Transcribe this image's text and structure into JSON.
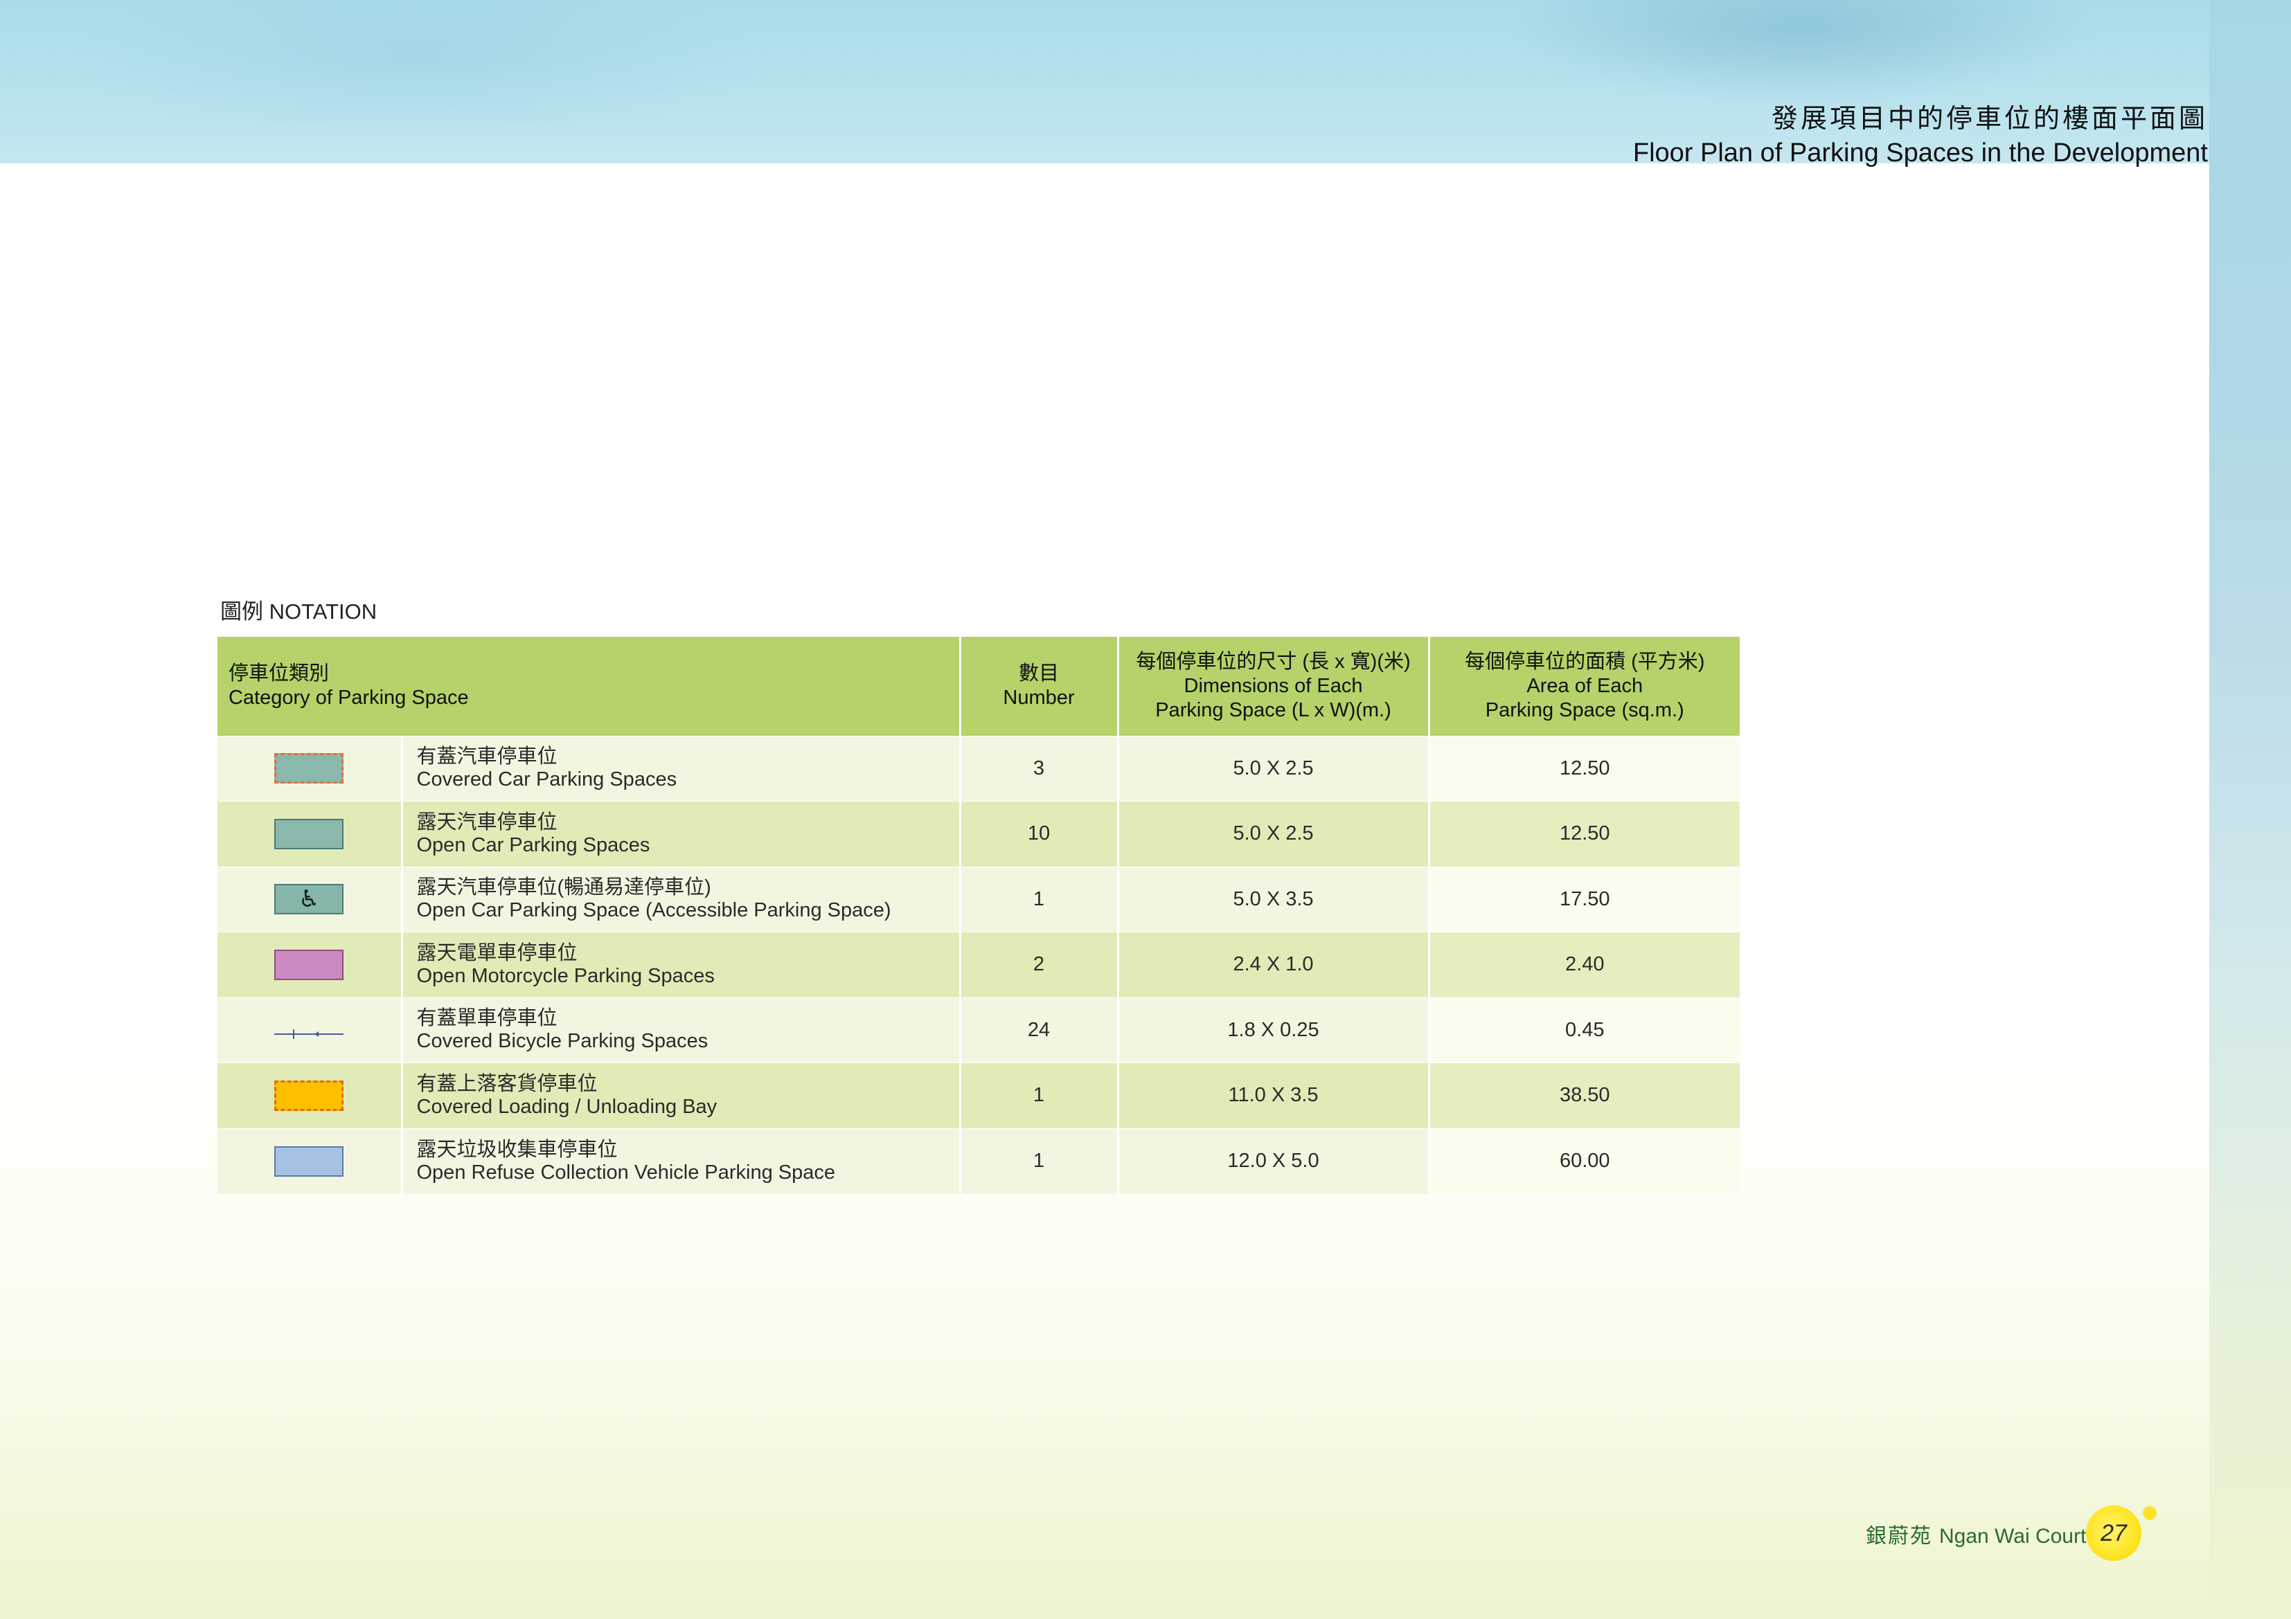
{
  "header": {
    "title_zh": "發展項目中的停車位的樓面平面圖",
    "title_en": "Floor Plan of Parking Spaces in the Development"
  },
  "notation": {
    "label": "圖例 NOTATION"
  },
  "table": {
    "headers": {
      "category_zh": "停車位類別",
      "category_en": "Category of Parking Space",
      "number_zh": "數目",
      "number_en": "Number",
      "dimension_zh": "每個停車位的尺寸 (長 x 寬)(米)",
      "dimension_en_1": "Dimensions of Each",
      "dimension_en_2": "Parking Space (L x W)(m.)",
      "area_zh": "每個停車位的面積 (平方米)",
      "area_en_1": "Area of Each",
      "area_en_2": "Parking Space (sq.m.)"
    },
    "rows": [
      {
        "symbol": "covered-car-symbol",
        "zh": "有蓋汽車停車位",
        "en": "Covered Car Parking Spaces",
        "number": "3",
        "dimension": "5.0 X 2.5",
        "area": "12.50"
      },
      {
        "symbol": "open-car-symbol",
        "zh": "露天汽車停車位",
        "en": "Open Car Parking Spaces",
        "number": "10",
        "dimension": "5.0 X 2.5",
        "area": "12.50"
      },
      {
        "symbol": "wheelchair-icon",
        "zh": "露天汽車停車位(暢通易達停車位)",
        "en": "Open Car Parking Space (Accessible Parking Space)",
        "number": "1",
        "dimension": "5.0 X 3.5",
        "area": "17.50"
      },
      {
        "symbol": "motorcycle-symbol",
        "zh": "露天電單車停車位",
        "en": "Open Motorcycle Parking Spaces",
        "number": "2",
        "dimension": "2.4 X 1.0",
        "area": "2.40"
      },
      {
        "symbol": "bicycle-symbol",
        "zh": "有蓋單車停車位",
        "en": "Covered Bicycle Parking Spaces",
        "number": "24",
        "dimension": "1.8 X 0.25",
        "area": "0.45"
      },
      {
        "symbol": "loading-bay-symbol",
        "zh": "有蓋上落客貨停車位",
        "en": "Covered Loading / Unloading Bay",
        "number": "1",
        "dimension": "11.0 X 3.5",
        "area": "38.50"
      },
      {
        "symbol": "refuse-vehicle-symbol",
        "zh": "露天垃圾收集車停車位",
        "en": "Open Refuse Collection Vehicle Parking Space",
        "number": "1",
        "dimension": "12.0 X 5.0",
        "area": "60.00"
      }
    ]
  },
  "footer": {
    "name_zh": "銀蔚苑",
    "name_en": "Ngan Wai Court",
    "page_number": "27"
  },
  "colors": {
    "header_green": "#b5d36a",
    "row_light": "#f2f6e1",
    "row_dark": "#e1ebb7",
    "covered_car": "#8ab8ad",
    "motorcycle": "#cc8bc0",
    "loading_bay": "#fcc000",
    "refuse_vehicle": "#a4c2e3",
    "footer_text": "#2a6b2c",
    "page_badge": "#ffe629"
  }
}
